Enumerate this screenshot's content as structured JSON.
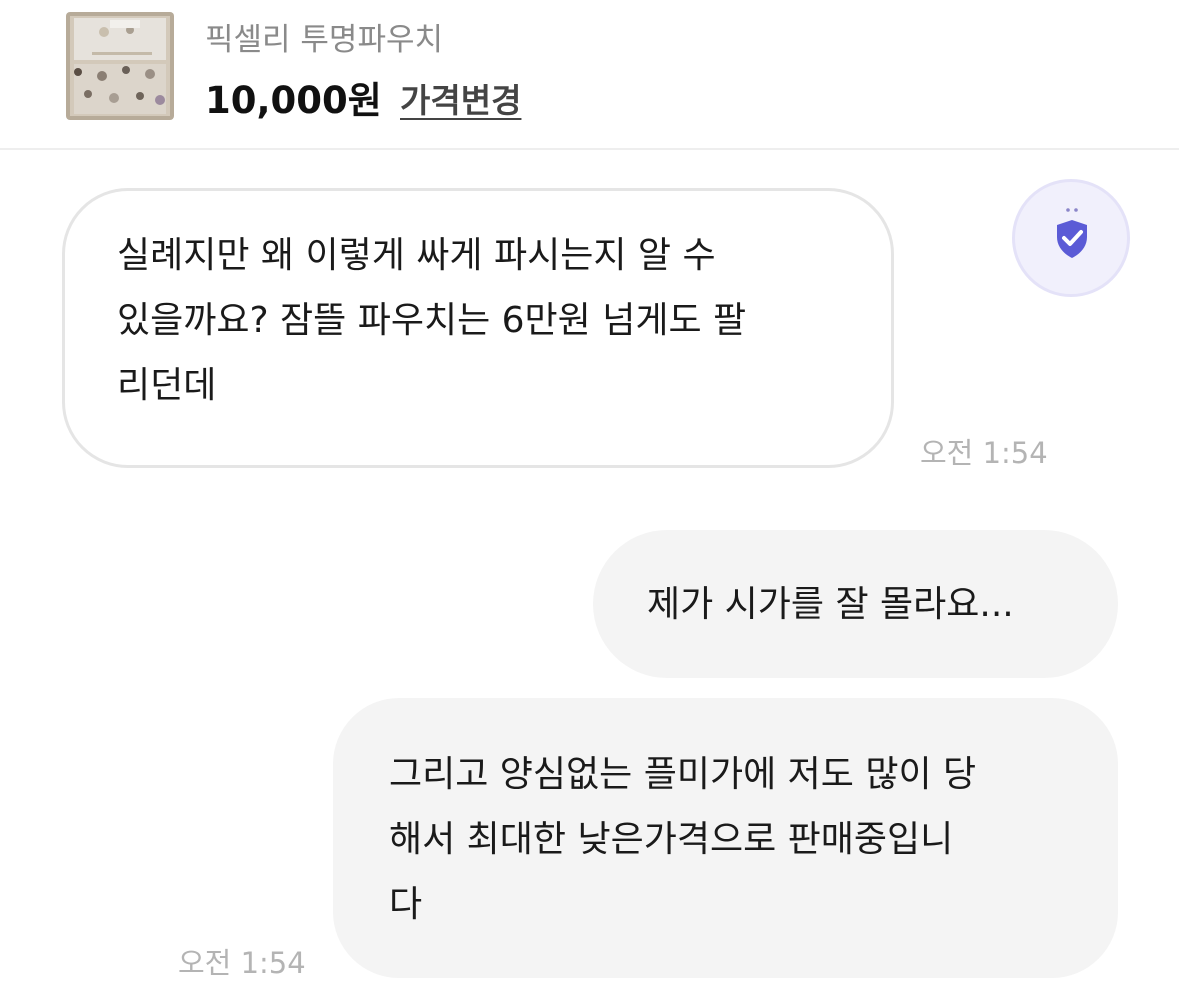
{
  "product": {
    "title": "픽셀리 투명파우치",
    "price": "10,000원",
    "price_change_label": "가격변경"
  },
  "messages": [
    {
      "direction": "incoming",
      "text": "실례지만 왜 이렇게 싸게 파시는지 알 수\n있을까요? 잠뜰 파우치는 6만원 넘게도 팔\n리던데",
      "time": "오전 1:54"
    },
    {
      "direction": "outgoing",
      "text": "제가 시가를 잘 몰라요..."
    },
    {
      "direction": "outgoing",
      "text": "그리고 양심없는 플미가에 저도 많이 당\n해서 최대한 낮은가격으로 판매중입니\n다",
      "time": "오전 1:54"
    }
  ],
  "icons": {
    "product_thumbnail": "product-photo-icon",
    "safety_badge": "shield-check-icon"
  },
  "colors": {
    "accent": "#5b5bd6",
    "badge_bg": "#f1f0fc",
    "outgoing_bubble": "#f4f4f4",
    "timestamp": "#b4b4b4"
  }
}
